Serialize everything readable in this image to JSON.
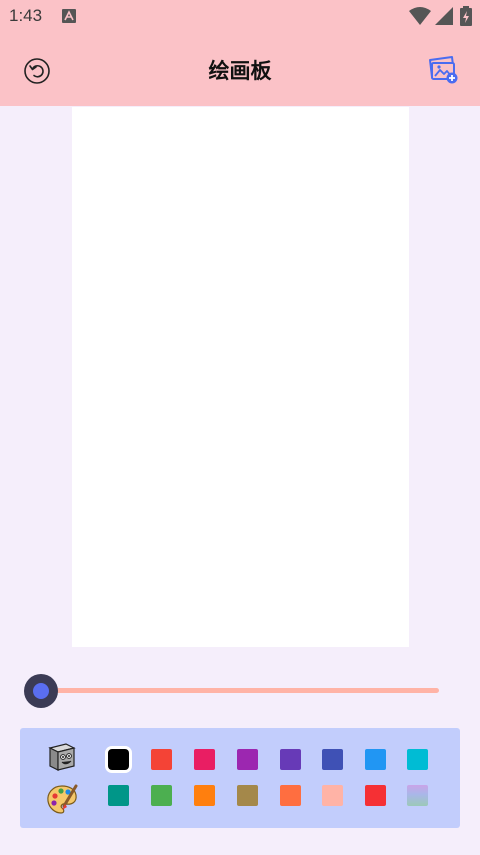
{
  "status_bar": {
    "time": "1:43"
  },
  "app_bar": {
    "title": "绘画板"
  },
  "brush_size": {
    "value_fraction": 0.0
  },
  "palette": {
    "tools": [
      "eraser-icon",
      "palette-icon"
    ],
    "selected_index": 0,
    "row1": [
      "#000000",
      "#f44336",
      "#e91e63",
      "#9c27b0",
      "#673ab7",
      "#3f51b5",
      "#2196f3",
      "#00bcd4"
    ],
    "row2": [
      "#009688",
      "#4caf50",
      "#ff7f0e",
      "#a4884a",
      "#ff6e40",
      "#ffb3a6",
      "#f53034",
      "gradient"
    ]
  }
}
